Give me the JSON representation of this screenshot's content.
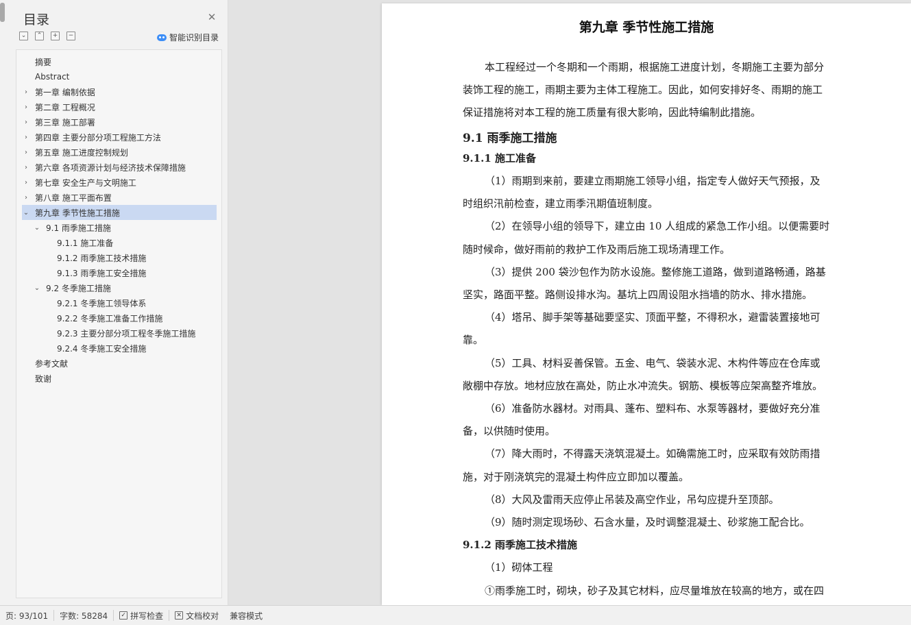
{
  "toc": {
    "title": "目录",
    "smart_toc_label": "智能识别目录",
    "items": [
      {
        "label": "摘要",
        "level": 0,
        "arrow": ""
      },
      {
        "label": "Abstract",
        "level": 0,
        "arrow": ""
      },
      {
        "label": "第一章 编制依据",
        "level": 0,
        "arrow": "›"
      },
      {
        "label": "第二章 工程概况",
        "level": 0,
        "arrow": "›"
      },
      {
        "label": "第三章 施工部署",
        "level": 0,
        "arrow": "›"
      },
      {
        "label": "第四章 主要分部分项工程施工方法",
        "level": 0,
        "arrow": "›"
      },
      {
        "label": "第五章 施工进度控制规划",
        "level": 0,
        "arrow": "›"
      },
      {
        "label": "第六章 各项资源计划与经济技术保障措施",
        "level": 0,
        "arrow": "›"
      },
      {
        "label": "第七章 安全生产与文明施工",
        "level": 0,
        "arrow": "›"
      },
      {
        "label": "第八章 施工平面布置",
        "level": 0,
        "arrow": "›"
      },
      {
        "label": "第九章 季节性施工措施",
        "level": 0,
        "arrow": "⌄",
        "selected": true
      },
      {
        "label": "9.1 雨季施工措施",
        "level": 1,
        "arrow": "⌄"
      },
      {
        "label": "9.1.1 施工准备",
        "level": 2,
        "arrow": ""
      },
      {
        "label": "9.1.2 雨季施工技术措施",
        "level": 2,
        "arrow": ""
      },
      {
        "label": "9.1.3 雨季施工安全措施",
        "level": 2,
        "arrow": ""
      },
      {
        "label": "9.2 冬季施工措施",
        "level": 1,
        "arrow": "⌄"
      },
      {
        "label": "9.2.1 冬季施工领导体系",
        "level": 2,
        "arrow": ""
      },
      {
        "label": "9.2.2 冬季施工准备工作措施",
        "level": 2,
        "arrow": ""
      },
      {
        "label": "9.2.3 主要分部分项工程冬季施工措施",
        "level": 2,
        "arrow": ""
      },
      {
        "label": "9.2.4 冬季施工安全措施",
        "level": 2,
        "arrow": ""
      },
      {
        "label": "参考文献",
        "level": 0,
        "arrow": ""
      },
      {
        "label": "致谢",
        "level": 0,
        "arrow": ""
      }
    ]
  },
  "document": {
    "chapter_title": "第九章 季节性施工措施",
    "lines": [
      {
        "text": "本工程经过一个冬期和一个雨期，根据施工进度计划，冬期施工主要为部分",
        "style": "para-first"
      },
      {
        "text": "装饰工程的施工，雨期主要为主体工程施工。因此，如何安排好冬、雨期的施工",
        "style": "para"
      },
      {
        "text": "保证措施将对本工程的施工质量有很大影响，因此特编制此措施。",
        "style": "para"
      },
      {
        "text": "9.1  雨季施工措施",
        "style": "h2"
      },
      {
        "text": "9.1.1  施工准备",
        "style": "h3"
      },
      {
        "text": "（1）雨期到来前，要建立雨期施工领导小组，指定专人做好天气预报，及",
        "style": "para-first"
      },
      {
        "text": "时组织汛前检查，建立雨季汛期值班制度。",
        "style": "para"
      },
      {
        "text": "（2）在领导小组的领导下，建立由 10 人组成的紧急工作小组。以便需要时",
        "style": "para-first"
      },
      {
        "text": "随时候命，做好雨前的救护工作及雨后施工现场清理工作。",
        "style": "para"
      },
      {
        "text": "（3）提供 200 袋沙包作为防水设施。整修施工道路，做到道路畅通，路基",
        "style": "para-first"
      },
      {
        "text": "坚实，路面平整。路侧设排水沟。基坑上四周设阻水挡墙的防水、排水措施。",
        "style": "para"
      },
      {
        "text": "（4）塔吊、脚手架等基础要坚实、顶面平整，不得积水，避雷装置接地可",
        "style": "para-first"
      },
      {
        "text": "靠。",
        "style": "para"
      },
      {
        "text": "（5）工具、材料妥善保管。五金、电气、袋装水泥、木构件等应在仓库或",
        "style": "para-first"
      },
      {
        "text": "敞棚中存放。地材应放在高处，防止水冲流失。钢筋、模板等应架高整齐堆放。",
        "style": "para"
      },
      {
        "text": "（6）准备防水器材。对雨具、蓬布、塑料布、水泵等器材，要做好充分准",
        "style": "para-first"
      },
      {
        "text": "备，以供随时使用。",
        "style": "para"
      },
      {
        "text": "（7）降大雨时，不得露天浇筑混凝土。如确需施工时，应采取有效防雨措",
        "style": "para-first"
      },
      {
        "text": "施，对于刚浇筑完的混凝土构件应立即加以覆盖。",
        "style": "para"
      },
      {
        "text": "（8）大风及雷雨天应停止吊装及高空作业，吊勾应提升至顶部。",
        "style": "para-first"
      },
      {
        "text": "（9）随时测定现场砂、石含水量，及时调整混凝土、砂浆施工配合比。",
        "style": "para-first"
      },
      {
        "text": "9.1.2  雨季施工技术措施",
        "style": "h3"
      },
      {
        "text": "（1）砌体工程",
        "style": "para-first"
      },
      {
        "text": "①雨季施工时，砌块，砂子及其它材料，应尽量堆放在较高的地方，或在四",
        "style": "para-first"
      }
    ]
  },
  "status_bar": {
    "page": "页: 93/101",
    "word_count": "字数: 58284",
    "spell_check": "拼写检查",
    "doc_proof": "文档校对",
    "compat_mode": "兼容模式"
  }
}
